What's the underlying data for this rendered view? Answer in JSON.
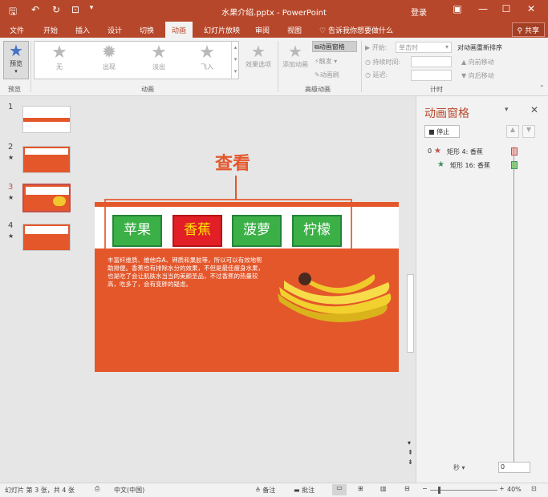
{
  "window": {
    "title": "水果介绍.pptx - PowerPoint",
    "login": "登录",
    "share": "共享",
    "tell_me": "告诉我你想要做什么"
  },
  "tabs": [
    "文件",
    "开始",
    "插入",
    "设计",
    "切换",
    "动画",
    "幻灯片放映",
    "审阅",
    "视图"
  ],
  "active_tab": "动画",
  "ribbon": {
    "preview_label": "预览",
    "preview_group": "预览",
    "animation_group": "动画",
    "advanced_group": "高级动画",
    "timing_group": "计时",
    "gallery": [
      "无",
      "出现",
      "淡出",
      "飞入"
    ],
    "effect_options": "效果选项",
    "add_animation": "添加动画",
    "animation_pane": "动画窗格",
    "trigger": "触发",
    "animation_painter": "动画刷",
    "start_label": "开始:",
    "start_value": "单击时",
    "duration_label": "持续时间:",
    "delay_label": "延迟:",
    "reorder_title": "对动画重新排序",
    "move_earlier": "向前移动",
    "move_later": "向后移动"
  },
  "thumbnails": [
    {
      "num": "1",
      "star": ""
    },
    {
      "num": "2",
      "star": "★"
    },
    {
      "num": "3",
      "star": "★"
    },
    {
      "num": "4",
      "star": "★"
    }
  ],
  "slide": {
    "heading": "查看",
    "buttons": [
      "苹果",
      "香蕉",
      "菠萝",
      "柠檬"
    ],
    "body_text": "丰富纤维质、维他命A、钾质和果胶等，所以可以有效地帮助排便。香蕉也有排除水分的效果，不但是最佳瘦身水果，也是吃了会让肌肤水当当的美颜圣品，不过香蕉的热量较高，吃多了，会有变胖的疑虑。"
  },
  "anim_pane": {
    "title": "动画窗格",
    "stop": "停止",
    "items": [
      {
        "index": "0",
        "label": "矩形 4: 香蕉",
        "color": "#c0504d"
      },
      {
        "index": "",
        "label": "矩形 16: 香蕉",
        "color": "#3f8f5a"
      }
    ],
    "seconds": "秒",
    "time_zero": "0"
  },
  "status": {
    "slide_info": "幻灯片 第 3 张，共 4 张",
    "language": "中文(中国)",
    "notes": "备注",
    "comments": "批注",
    "zoom": "40%"
  },
  "colors": {
    "accent": "#b7472a",
    "slide_orange": "#e4572b",
    "btn_green": "#3bb046",
    "btn_red": "#e21f26"
  }
}
